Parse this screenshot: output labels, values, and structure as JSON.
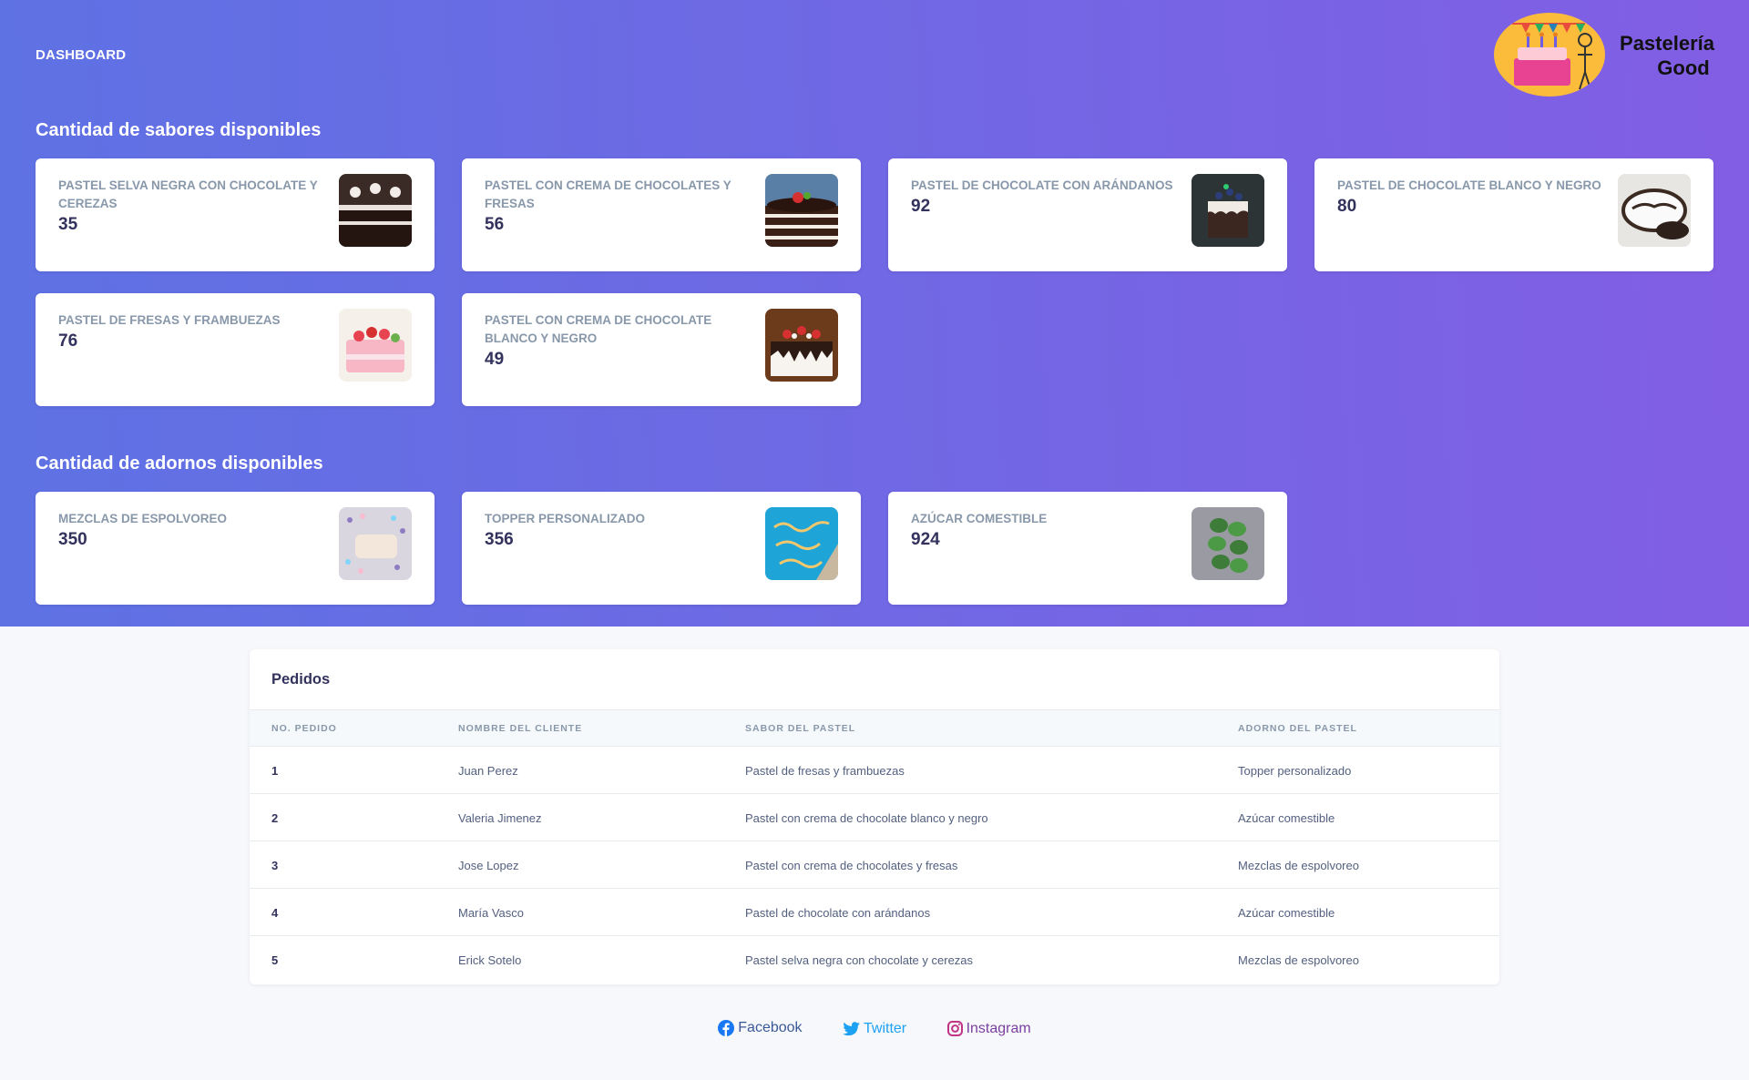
{
  "nav": {
    "title": "DASHBOARD"
  },
  "logo": {
    "line1": "Pastelería",
    "line2": "Good"
  },
  "flavors": {
    "title": "Cantidad de sabores disponibles",
    "items": [
      {
        "name": "PASTEL SELVA NEGRA CON CHOCOLATE Y CEREZAS",
        "value": "35"
      },
      {
        "name": "PASTEL CON CREMA DE CHOCOLATES Y FRESAS",
        "value": "56"
      },
      {
        "name": "PASTEL DE CHOCOLATE CON ARÁNDANOS",
        "value": "92"
      },
      {
        "name": "PASTEL DE CHOCOLATE BLANCO Y NEGRO",
        "value": "80"
      },
      {
        "name": "PASTEL DE FRESAS Y FRAMBUEZAS",
        "value": "76"
      },
      {
        "name": "PASTEL CON CREMA DE CHOCOLATE BLANCO Y NEGRO",
        "value": "49"
      }
    ]
  },
  "toppings": {
    "title": "Cantidad de adornos disponibles",
    "items": [
      {
        "name": "MEZCLAS DE ESPOLVOREO",
        "value": "350"
      },
      {
        "name": "TOPPER PERSONALIZADO",
        "value": "356"
      },
      {
        "name": "AZÚCAR COMESTIBLE",
        "value": "924"
      }
    ]
  },
  "orders": {
    "title": "Pedidos",
    "columns": [
      "NO. PEDIDO",
      "NOMBRE DEL CLIENTE",
      "SABOR DEL PASTEL",
      "ADORNO DEL PASTEL"
    ],
    "rows": [
      {
        "no": "1",
        "client": "Juan Perez",
        "flavor": "Pastel de fresas y frambuezas",
        "topping": "Topper personalizado"
      },
      {
        "no": "2",
        "client": "Valeria Jimenez",
        "flavor": "Pastel con crema de chocolate blanco y negro",
        "topping": "Azúcar comestible"
      },
      {
        "no": "3",
        "client": "Jose Lopez",
        "flavor": "Pastel con crema de chocolates y fresas",
        "topping": "Mezclas de espolvoreo"
      },
      {
        "no": "4",
        "client": "María Vasco",
        "flavor": "Pastel de chocolate con arándanos",
        "topping": "Azúcar comestible"
      },
      {
        "no": "5",
        "client": "Erick Sotelo",
        "flavor": "Pastel selva negra con chocolate y cerezas",
        "topping": "Mezclas de espolvoreo"
      }
    ]
  },
  "footer": {
    "facebook": "Facebook",
    "twitter": "Twitter",
    "instagram": "Instagram"
  },
  "colors": {
    "gradient_start": "#5e72e4",
    "gradient_end": "#825ee4",
    "facebook": "#3b5998",
    "twitter": "#1da1f2",
    "instagram": "#c13584"
  },
  "icons": {
    "flavor_thumbs": [
      "cake-photo",
      "cake-photo",
      "cake-photo",
      "cake-photo",
      "cake-photo",
      "cake-photo"
    ],
    "topping_thumbs": [
      "sprinkles-photo",
      "topper-photo",
      "edible-sugar-photo"
    ],
    "footer": [
      "facebook-icon",
      "twitter-icon",
      "instagram-icon"
    ]
  }
}
